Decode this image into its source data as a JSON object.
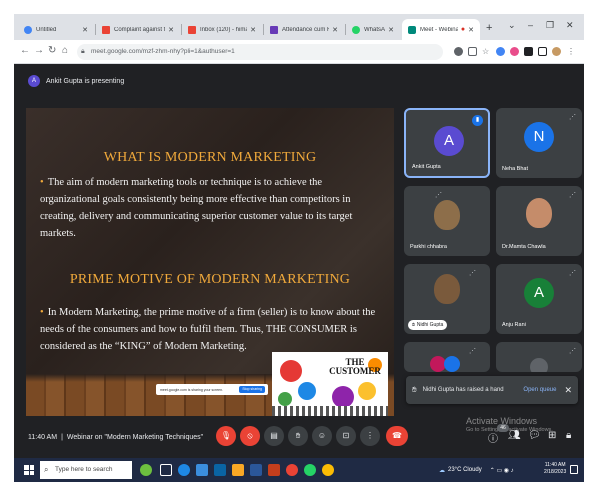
{
  "browser": {
    "tabs": [
      {
        "label": "Untitled",
        "icon": "chrome-icon",
        "color": "#4285f4",
        "active": false
      },
      {
        "label": "Complaint against th",
        "icon": "gmail-icon",
        "color": "#ea4335",
        "active": false
      },
      {
        "label": "Inbox (120) - himansh",
        "icon": "gmail-icon",
        "color": "#ea4335",
        "active": false
      },
      {
        "label": "Attendance cum Fee",
        "icon": "forms-icon",
        "color": "#673ab7",
        "active": false
      },
      {
        "label": "WhatsApp",
        "icon": "whatsapp-icon",
        "color": "#25d366",
        "active": false
      },
      {
        "label": "Meet - Webinar",
        "icon": "meet-icon",
        "color": "#00897b",
        "active": true
      }
    ],
    "url": "meet.google.com/mzf-zhm-nhy?pli=1&authuser=1"
  },
  "meet": {
    "presenter_initial": "A",
    "presenting_text": "Ankit Gupta is presenting",
    "slide": {
      "heading1": "WHAT IS MODERN MARKETING",
      "para1": "The aim of modern marketing tools or technique is to achieve the organizational goals consistently being more effective than competitors in creating, delivery and communicating superior customer value to its target markets.",
      "heading2": "PRIME MOTIVE OF MODERN MARKETING",
      "para2": "In Modern Marketing, the prime motive of a firm (seller) is to know about the needs of the consumers and how to fulfil them. Thus, THE CONSUMER is considered as the “KING” of Modern Marketing.",
      "image_text": "THE CUSTOMER",
      "share_text": "meet.google.com is sharing your screen.",
      "share_button": "Stop sharing"
    },
    "participants": [
      {
        "name": "Ankit Gupta",
        "initial": "A",
        "color": "#5a4bd1",
        "speaking": true
      },
      {
        "name": "Neha Bhat",
        "initial": "N",
        "color": "#1a73e8"
      },
      {
        "name": "Parkhi chhabra",
        "initial": "",
        "color": "#8d6e4a"
      },
      {
        "name": "Dr.Mamta Chawla",
        "initial": "",
        "color": "#c58c6a"
      },
      {
        "name": "Nidhi Gupta",
        "initial": "",
        "color": "#7a5a3c",
        "hand_raised": true
      },
      {
        "name": "Anju Rani",
        "initial": "A",
        "color": "#188038"
      }
    ],
    "toast": {
      "message": "Nidhi Gupta has raised a hand",
      "action": "Open queue"
    },
    "footer": {
      "time": "11:40 AM",
      "meeting_title": "Webinar on \"Modern Marketing Techniques\"",
      "participant_count": "46"
    },
    "watermark": {
      "line1": "Activate Windows",
      "line2": "Go to Settings to activate Windows."
    }
  },
  "taskbar": {
    "search_placeholder": "Type here to search",
    "weather": "23°C Cloudy",
    "time": "11:40 AM",
    "date": "2/18/2023"
  }
}
